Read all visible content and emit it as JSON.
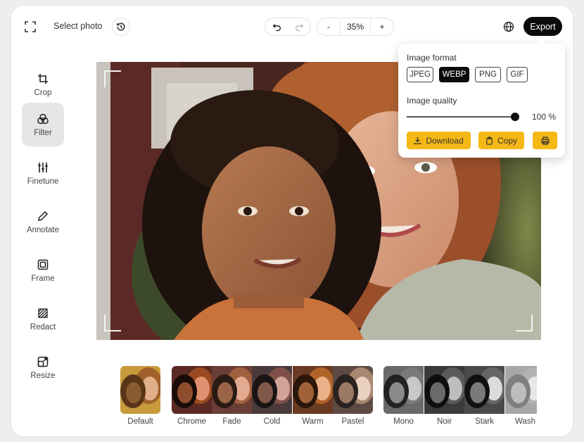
{
  "toolbar": {
    "fullscreen_icon": "fullscreen-icon",
    "select_photo": "Select photo",
    "history_icon": "history-icon",
    "undo_icon": "undo-icon",
    "redo_icon": "redo-icon",
    "zoom_minus": "-",
    "zoom_value": "35%",
    "zoom_plus": "+",
    "globe_icon": "globe-icon",
    "export_label": "Export"
  },
  "sidebar": {
    "items": [
      {
        "label": "Crop",
        "icon": "crop-icon"
      },
      {
        "label": "Filter",
        "icon": "filter-icon",
        "active": true
      },
      {
        "label": "Finetune",
        "icon": "sliders-icon"
      },
      {
        "label": "Annotate",
        "icon": "pencil-icon"
      },
      {
        "label": "Frame",
        "icon": "frame-icon"
      },
      {
        "label": "Redact",
        "icon": "redact-icon"
      },
      {
        "label": "Resize",
        "icon": "resize-icon"
      }
    ]
  },
  "export_panel": {
    "format_label": "Image format",
    "formats": [
      "JPEG",
      "WEBP",
      "PNG",
      "GIF"
    ],
    "selected_format": "WEBP",
    "quality_label": "Image quality",
    "quality_value": "100 %",
    "quality_fraction": 1.0,
    "download_label": "Download",
    "copy_label": "Copy",
    "print_icon": "print-icon"
  },
  "filters": {
    "items": [
      {
        "label": "Default"
      },
      {
        "label": "Chrome"
      },
      {
        "label": "Fade"
      },
      {
        "label": "Cold"
      },
      {
        "label": "Warm"
      },
      {
        "label": "Pastel"
      },
      {
        "label": "Mono"
      },
      {
        "label": "Noir"
      },
      {
        "label": "Stark"
      },
      {
        "label": "Wash"
      }
    ]
  },
  "colors": {
    "accent_yellow": "#f5b815",
    "export_black": "#0b0b0b",
    "active_sidebar_bg": "#e4e6e8"
  }
}
